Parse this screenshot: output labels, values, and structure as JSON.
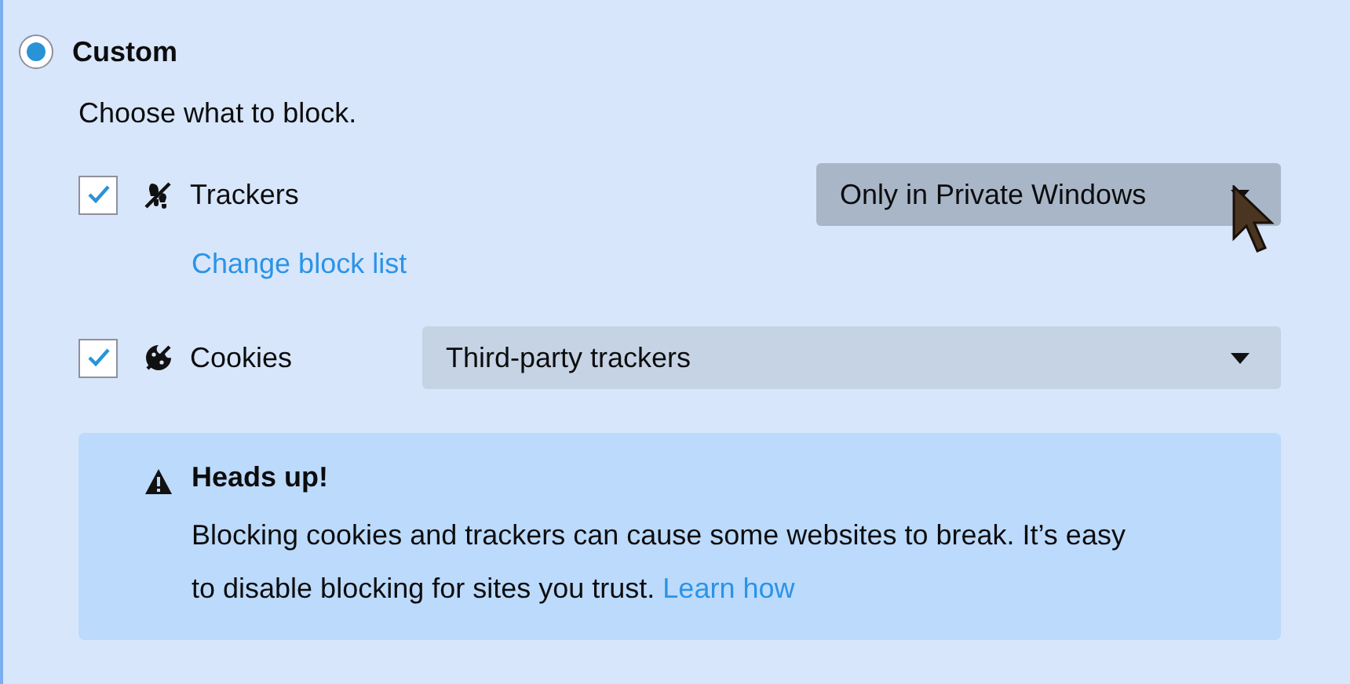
{
  "option": {
    "label": "Custom",
    "selected": true
  },
  "intro": "Choose what to block.",
  "items": [
    {
      "kind": "trackers",
      "label": "Trackers",
      "checked": true,
      "dropdown": {
        "value": "Only in Private Windows",
        "hovered": true
      },
      "link": "Change block list"
    },
    {
      "kind": "cookies",
      "label": "Cookies",
      "checked": true,
      "dropdown": {
        "value": "Third-party trackers",
        "hovered": false
      }
    }
  ],
  "notice": {
    "title": "Heads up!",
    "text": "Blocking cookies and trackers can cause some websites to break. It’s easy to disable blocking for sites you trust.",
    "link": "Learn how"
  }
}
